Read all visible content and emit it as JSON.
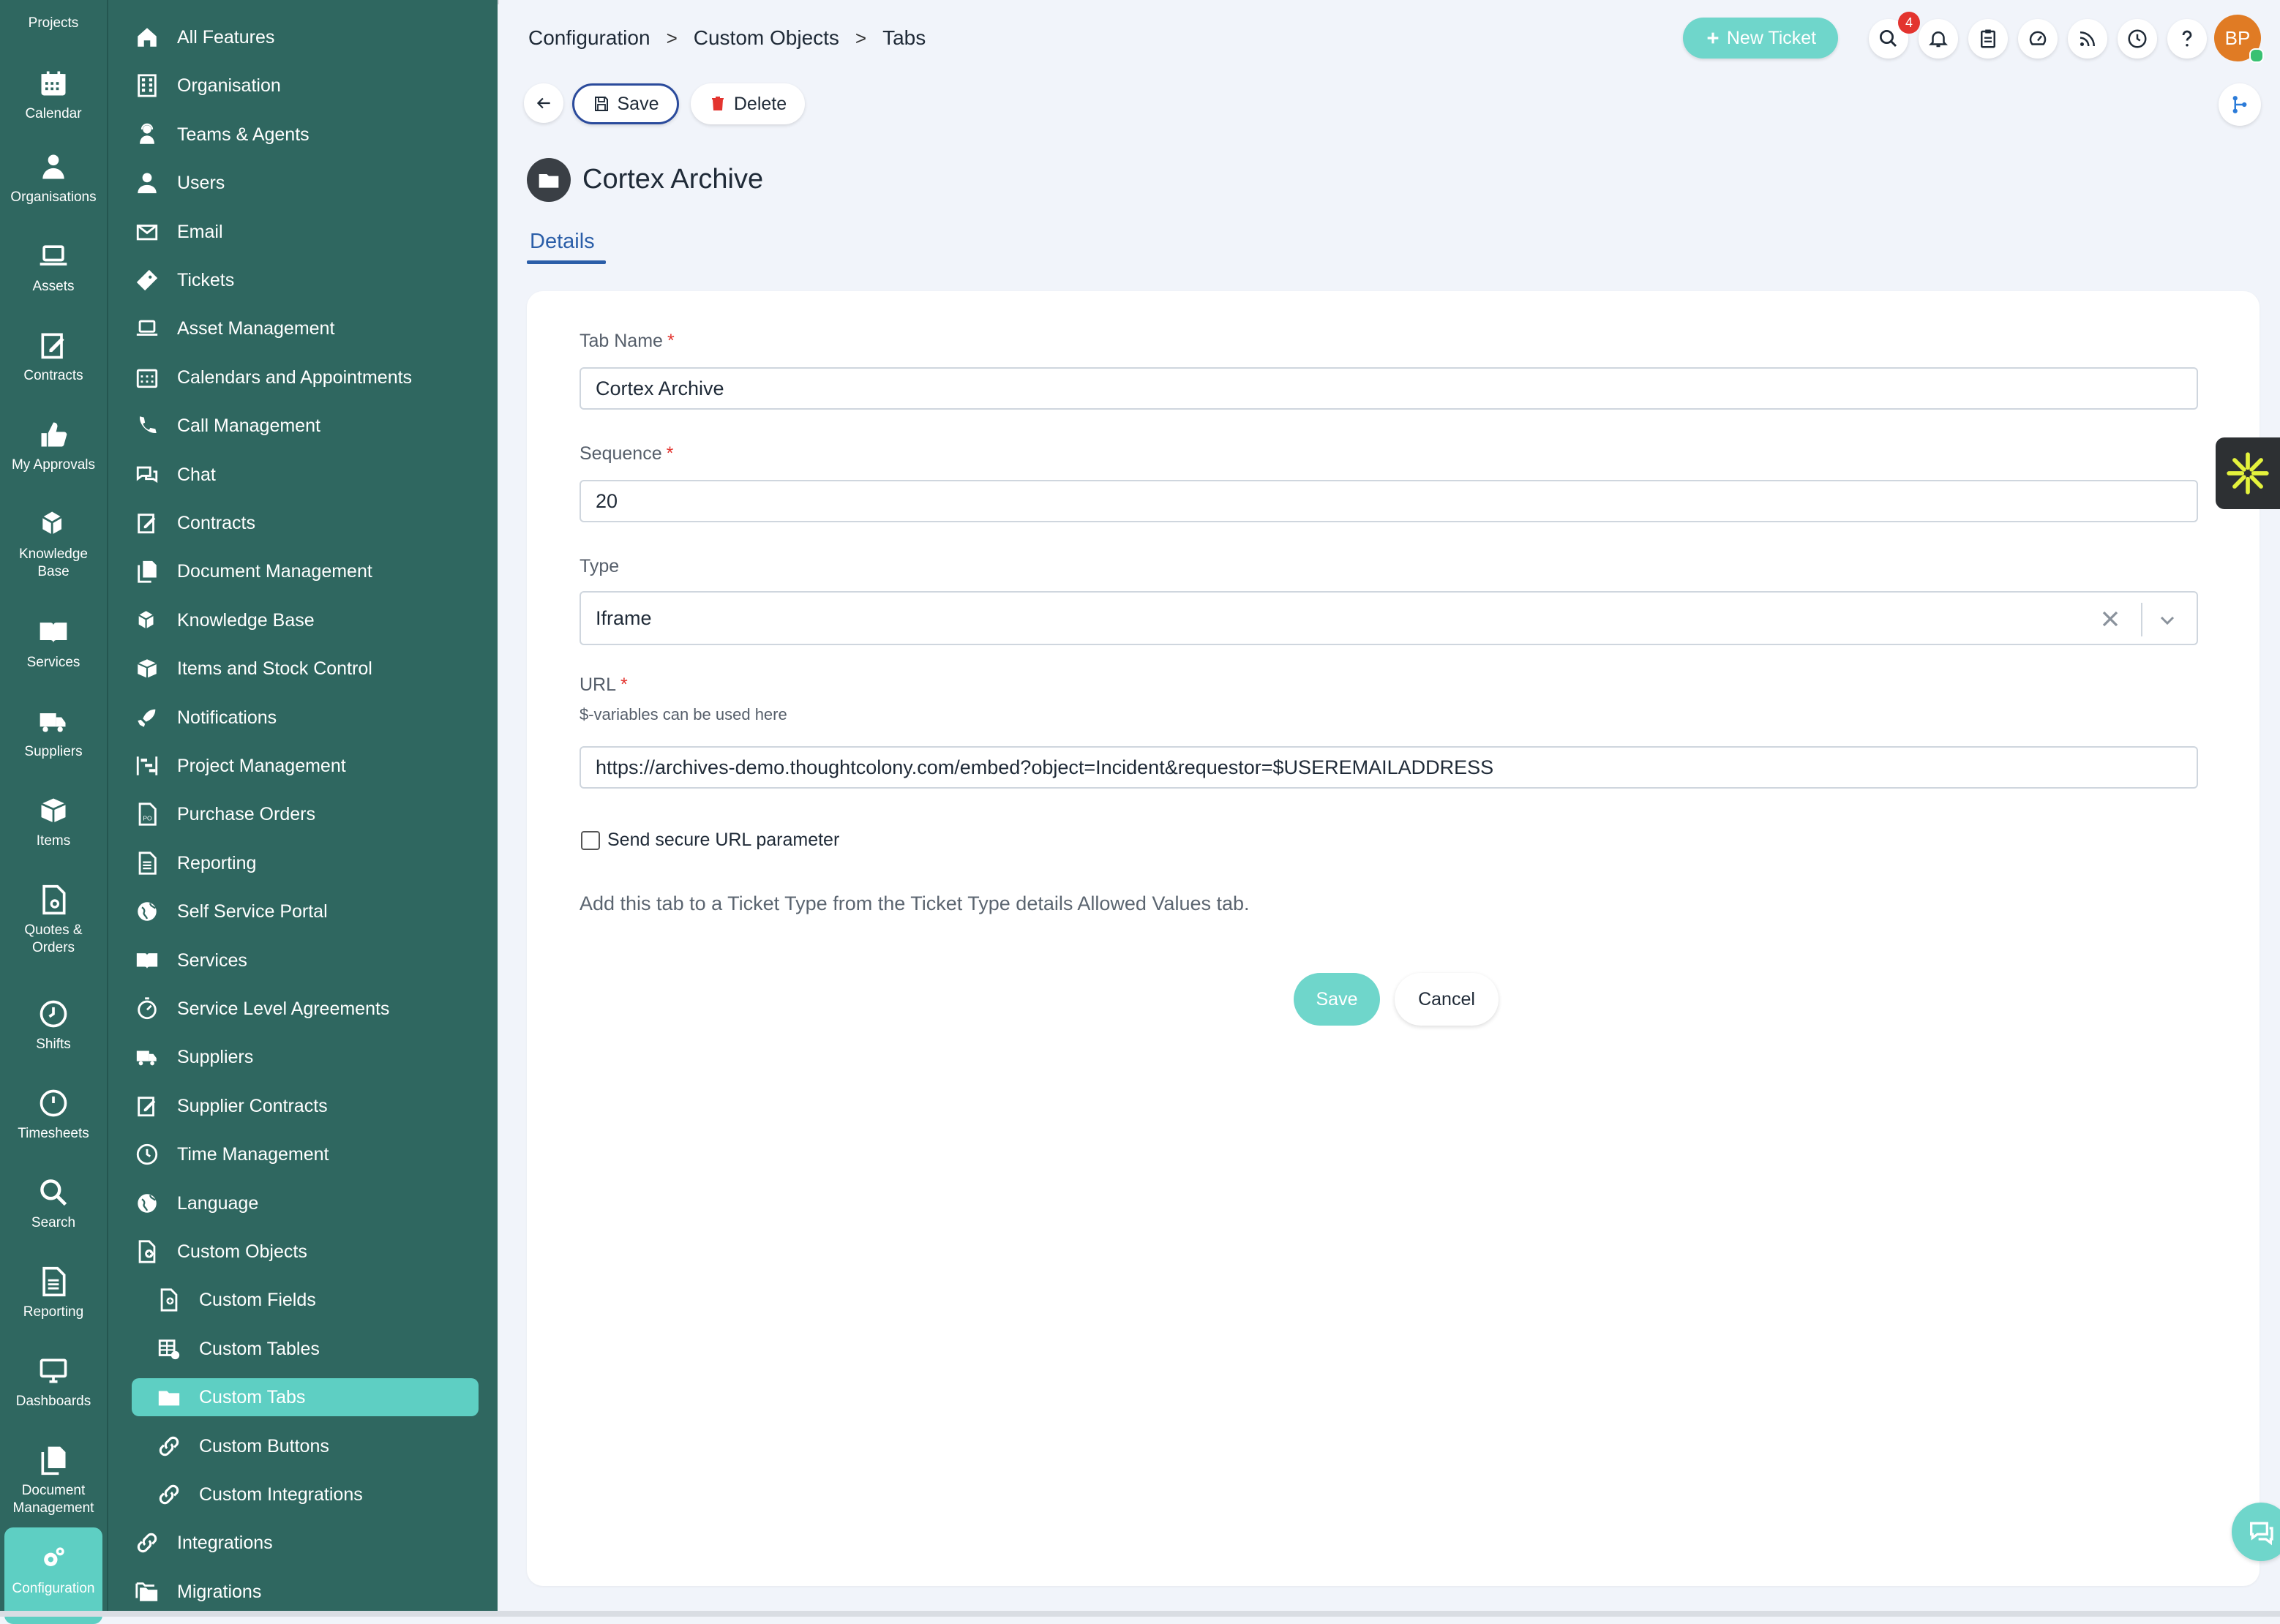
{
  "rail": {
    "items": [
      {
        "label": "Projects",
        "icon": "projects-icon"
      },
      {
        "label": "Calendar",
        "icon": "calendar-icon"
      },
      {
        "label": "Organisations",
        "icon": "person-icon"
      },
      {
        "label": "Assets",
        "icon": "laptop-icon"
      },
      {
        "label": "Contracts",
        "icon": "contract-icon"
      },
      {
        "label": "My Approvals",
        "icon": "thumbs-up-icon"
      },
      {
        "label": "Knowledge Base",
        "icon": "cubes-icon"
      },
      {
        "label": "Services",
        "icon": "book-icon"
      },
      {
        "label": "Suppliers",
        "icon": "truck-icon"
      },
      {
        "label": "Items",
        "icon": "box-icon"
      },
      {
        "label": "Quotes & Orders",
        "icon": "quote-document-icon"
      },
      {
        "label": "Shifts",
        "icon": "clock-icon"
      },
      {
        "label": "Timesheets",
        "icon": "clock-icon"
      },
      {
        "label": "Search",
        "icon": "search-icon"
      },
      {
        "label": "Reporting",
        "icon": "report-document-icon"
      },
      {
        "label": "Dashboards",
        "icon": "monitor-icon"
      },
      {
        "label": "Document Management",
        "icon": "documents-icon"
      },
      {
        "label": "Configuration",
        "icon": "gears-icon"
      }
    ]
  },
  "nav": {
    "items": [
      {
        "label": "All Features",
        "icon": "home-icon"
      },
      {
        "label": "Organisation",
        "icon": "building-icon"
      },
      {
        "label": "Teams & Agents",
        "icon": "agent-icon"
      },
      {
        "label": "Users",
        "icon": "user-icon"
      },
      {
        "label": "Email",
        "icon": "email-icon"
      },
      {
        "label": "Tickets",
        "icon": "ticket-icon"
      },
      {
        "label": "Asset Management",
        "icon": "laptop-icon"
      },
      {
        "label": "Calendars and Appointments",
        "icon": "calendar-icon"
      },
      {
        "label": "Call Management",
        "icon": "phone-icon"
      },
      {
        "label": "Chat",
        "icon": "chat-icon"
      },
      {
        "label": "Contracts",
        "icon": "contract-icon"
      },
      {
        "label": "Document Management",
        "icon": "documents-icon"
      },
      {
        "label": "Knowledge Base",
        "icon": "cubes-icon"
      },
      {
        "label": "Items and Stock Control",
        "icon": "box-icon"
      },
      {
        "label": "Notifications",
        "icon": "rocket-icon"
      },
      {
        "label": "Project Management",
        "icon": "gantt-icon"
      },
      {
        "label": "Purchase Orders",
        "icon": "po-document-icon"
      },
      {
        "label": "Reporting",
        "icon": "report-document-icon"
      },
      {
        "label": "Self Service Portal",
        "icon": "globe-icon"
      },
      {
        "label": "Services",
        "icon": "book-icon"
      },
      {
        "label": "Service Level Agreements",
        "icon": "stopwatch-icon"
      },
      {
        "label": "Suppliers",
        "icon": "truck-icon"
      },
      {
        "label": "Supplier Contracts",
        "icon": "contract-icon"
      },
      {
        "label": "Time Management",
        "icon": "clock-icon"
      },
      {
        "label": "Language",
        "icon": "globe-icon"
      },
      {
        "label": "Custom Objects",
        "icon": "custom-object-icon"
      },
      {
        "label": "Custom Fields",
        "icon": "custom-field-icon",
        "sub": true
      },
      {
        "label": "Custom Tables",
        "icon": "table-icon",
        "sub": true
      },
      {
        "label": "Custom Tabs",
        "icon": "folder-icon",
        "sub": true,
        "active": true
      },
      {
        "label": "Custom Buttons",
        "icon": "link-icon",
        "sub": true
      },
      {
        "label": "Custom Integrations",
        "icon": "link-icon",
        "sub": true
      },
      {
        "label": "Integrations",
        "icon": "link-icon"
      },
      {
        "label": "Migrations",
        "icon": "folders-icon"
      }
    ]
  },
  "header": {
    "breadcrumb": [
      "Configuration",
      "Custom Objects",
      "Tabs"
    ],
    "breadcrumb_sep": ">",
    "new_ticket_label": "New Ticket",
    "notification_count": "4",
    "avatar_initials": "BP",
    "icons": [
      "search-icon",
      "bell-icon",
      "clipboard-icon",
      "dashboard-gauge-icon",
      "rss-icon",
      "clock-icon",
      "help-icon"
    ]
  },
  "toolbar": {
    "save_label": "Save",
    "delete_label": "Delete"
  },
  "object": {
    "title": "Cortex Archive",
    "tab_details": "Details"
  },
  "form": {
    "tab_name_label": "Tab Name",
    "tab_name_value": "Cortex Archive",
    "sequence_label": "Sequence",
    "sequence_value": "20",
    "type_label": "Type",
    "type_value": "Iframe",
    "url_label": "URL",
    "url_hint": "$-variables can be used here",
    "url_value": "https://archives-demo.thoughtcolony.com/embed?object=Incident&requestor=$USEREMAILADDRESS",
    "required_mark": "*",
    "secure_label": "Send secure URL parameter",
    "secure_checked": false,
    "info_text": "Add this tab to a Ticket Type from the Ticket Type details Allowed Values tab.",
    "save_label": "Save",
    "cancel_label": "Cancel"
  },
  "colors": {
    "sidebar": "#2f6760",
    "accent": "#5ecfc3",
    "primary_border": "#2b4b9c",
    "danger": "#e3342f",
    "avatar": "#e07b24"
  }
}
